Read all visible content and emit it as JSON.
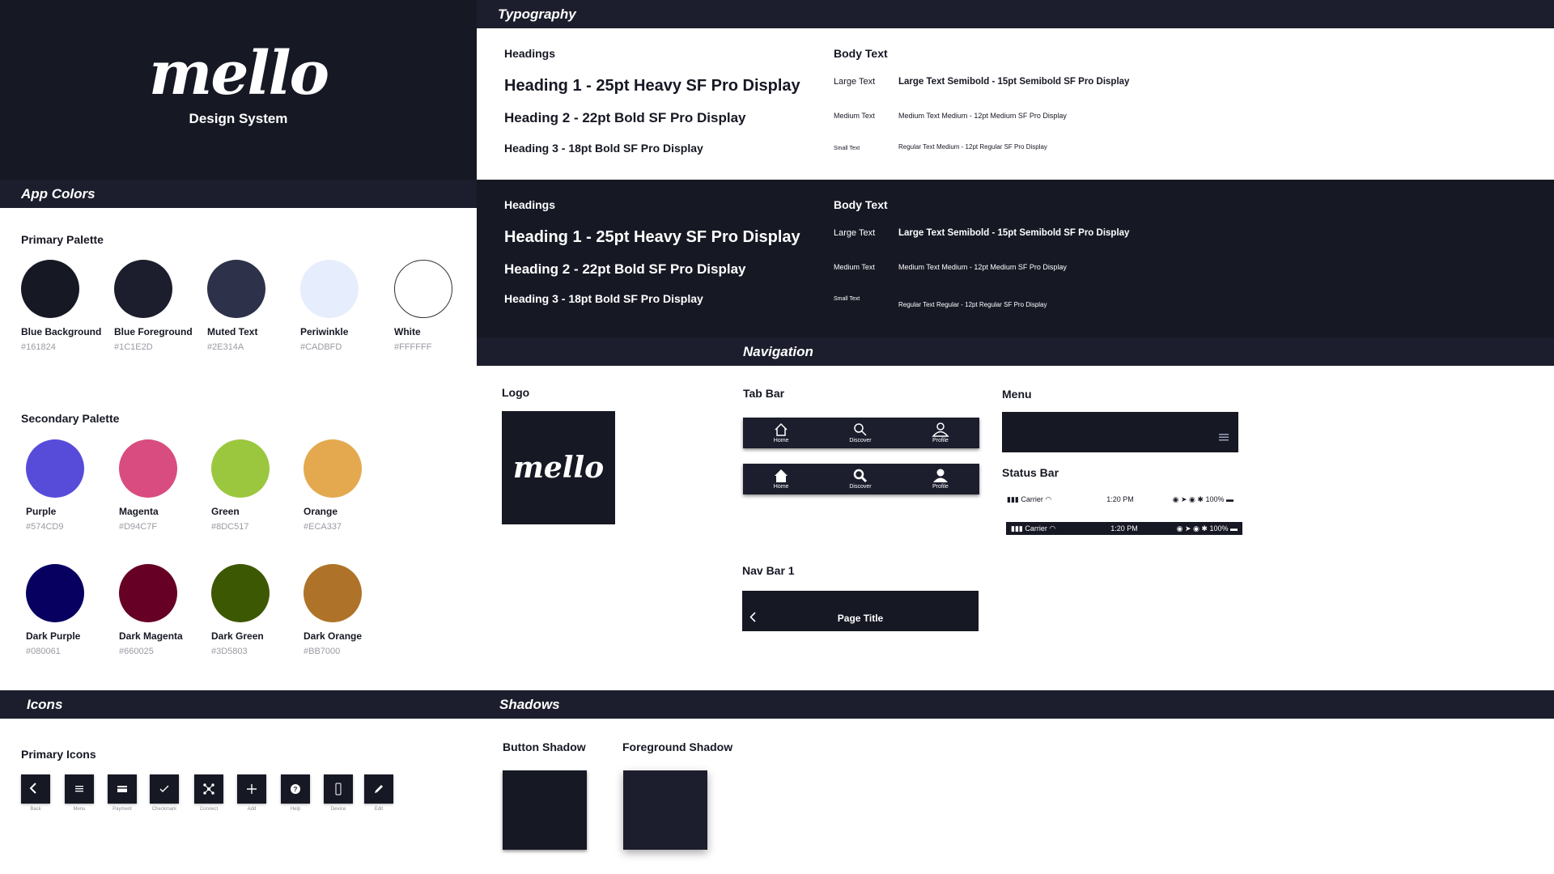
{
  "hero": {
    "logo": "mello",
    "subtitle": "Design System"
  },
  "sections": {
    "typography": "Typography",
    "app_colors": "App Colors",
    "navigation": "Navigation",
    "icons": "Icons",
    "shadows": "Shadows"
  },
  "typography": {
    "headings_title": "Headings",
    "body_title": "Body Text",
    "light": {
      "h1": "Heading 1 - 25pt Heavy SF Pro Display",
      "h2": "Heading 2 - 22pt Bold SF Pro Display",
      "h3": "Heading 3 - 18pt Bold SF Pro Display",
      "large_label": "Large Text",
      "large_sample": "Large Text Semibold - 15pt Semibold SF Pro Display",
      "medium_label": "Medium Text",
      "medium_sample": "Medium Text Medium - 12pt Medium SF Pro Display",
      "small_label": "Small Text",
      "small_sample": "Regular Text Medium - 12pt Regular SF Pro Display"
    },
    "dark": {
      "h1": "Heading 1 - 25pt Heavy SF Pro Display",
      "h2": "Heading 2 - 22pt Bold SF Pro Display",
      "h3": "Heading 3 - 18pt Bold SF Pro Display",
      "large_label": "Large Text",
      "large_sample": "Large Text Semibold - 15pt Semibold SF Pro Display",
      "medium_label": "Medium Text",
      "medium_sample": "Medium Text Medium - 12pt Medium SF Pro Display",
      "small_label": "Small Text",
      "small_sample": "Regular Text Regular - 12pt Regular SF Pro Display"
    }
  },
  "colors": {
    "primary_title": "Primary Palette",
    "secondary_title": "Secondary Palette",
    "primary": [
      {
        "name": "Blue Background",
        "hex": "#161824",
        "color": "#161824"
      },
      {
        "name": "Blue Foreground",
        "hex": "#1C1E2D",
        "color": "#1C1E2D"
      },
      {
        "name": "Muted Text",
        "hex": "#2E314A",
        "color": "#2E314A"
      },
      {
        "name": "Periwinkle",
        "hex": "#CADBFD",
        "color": "#E6EDFD"
      },
      {
        "name": "White",
        "hex": "#FFFFFF",
        "color": "#FFFFFF"
      }
    ],
    "secondary": [
      {
        "name": "Purple",
        "hex": "#574CD9",
        "color": "#574CD9"
      },
      {
        "name": "Magenta",
        "hex": "#D94C7F",
        "color": "#D94C7F"
      },
      {
        "name": "Green",
        "hex": "#8DC517",
        "color": "#9BC73F"
      },
      {
        "name": "Orange",
        "hex": "#ECA337",
        "color": "#E4A94F"
      },
      {
        "name": "Dark Purple",
        "hex": "#080061",
        "color": "#080061"
      },
      {
        "name": "Dark Magenta",
        "hex": "#660025",
        "color": "#660025"
      },
      {
        "name": "Dark Green",
        "hex": "#3D5803",
        "color": "#3D5803"
      },
      {
        "name": "Dark Orange",
        "hex": "#BB7000",
        "color": "#AE7328"
      }
    ]
  },
  "navigation": {
    "logo_title": "Logo",
    "logo_text": "mello",
    "tabbar_title": "Tab Bar",
    "tabs": [
      "Home",
      "Discover",
      "Profile"
    ],
    "menu_title": "Menu",
    "statusbar_title": "Status Bar",
    "status": {
      "carrier": "Carrier",
      "time": "1:20 PM",
      "battery": "100%"
    },
    "navbar_title": "Nav Bar 1",
    "page_title": "Page Title"
  },
  "icons": {
    "title": "Primary Icons",
    "items": [
      "Back",
      "Menu",
      "Payment",
      "Checkmark",
      "Connect",
      "Add",
      "Help",
      "Device",
      "Edit"
    ]
  },
  "shadows": {
    "button": "Button Shadow",
    "foreground": "Foreground Shadow"
  }
}
